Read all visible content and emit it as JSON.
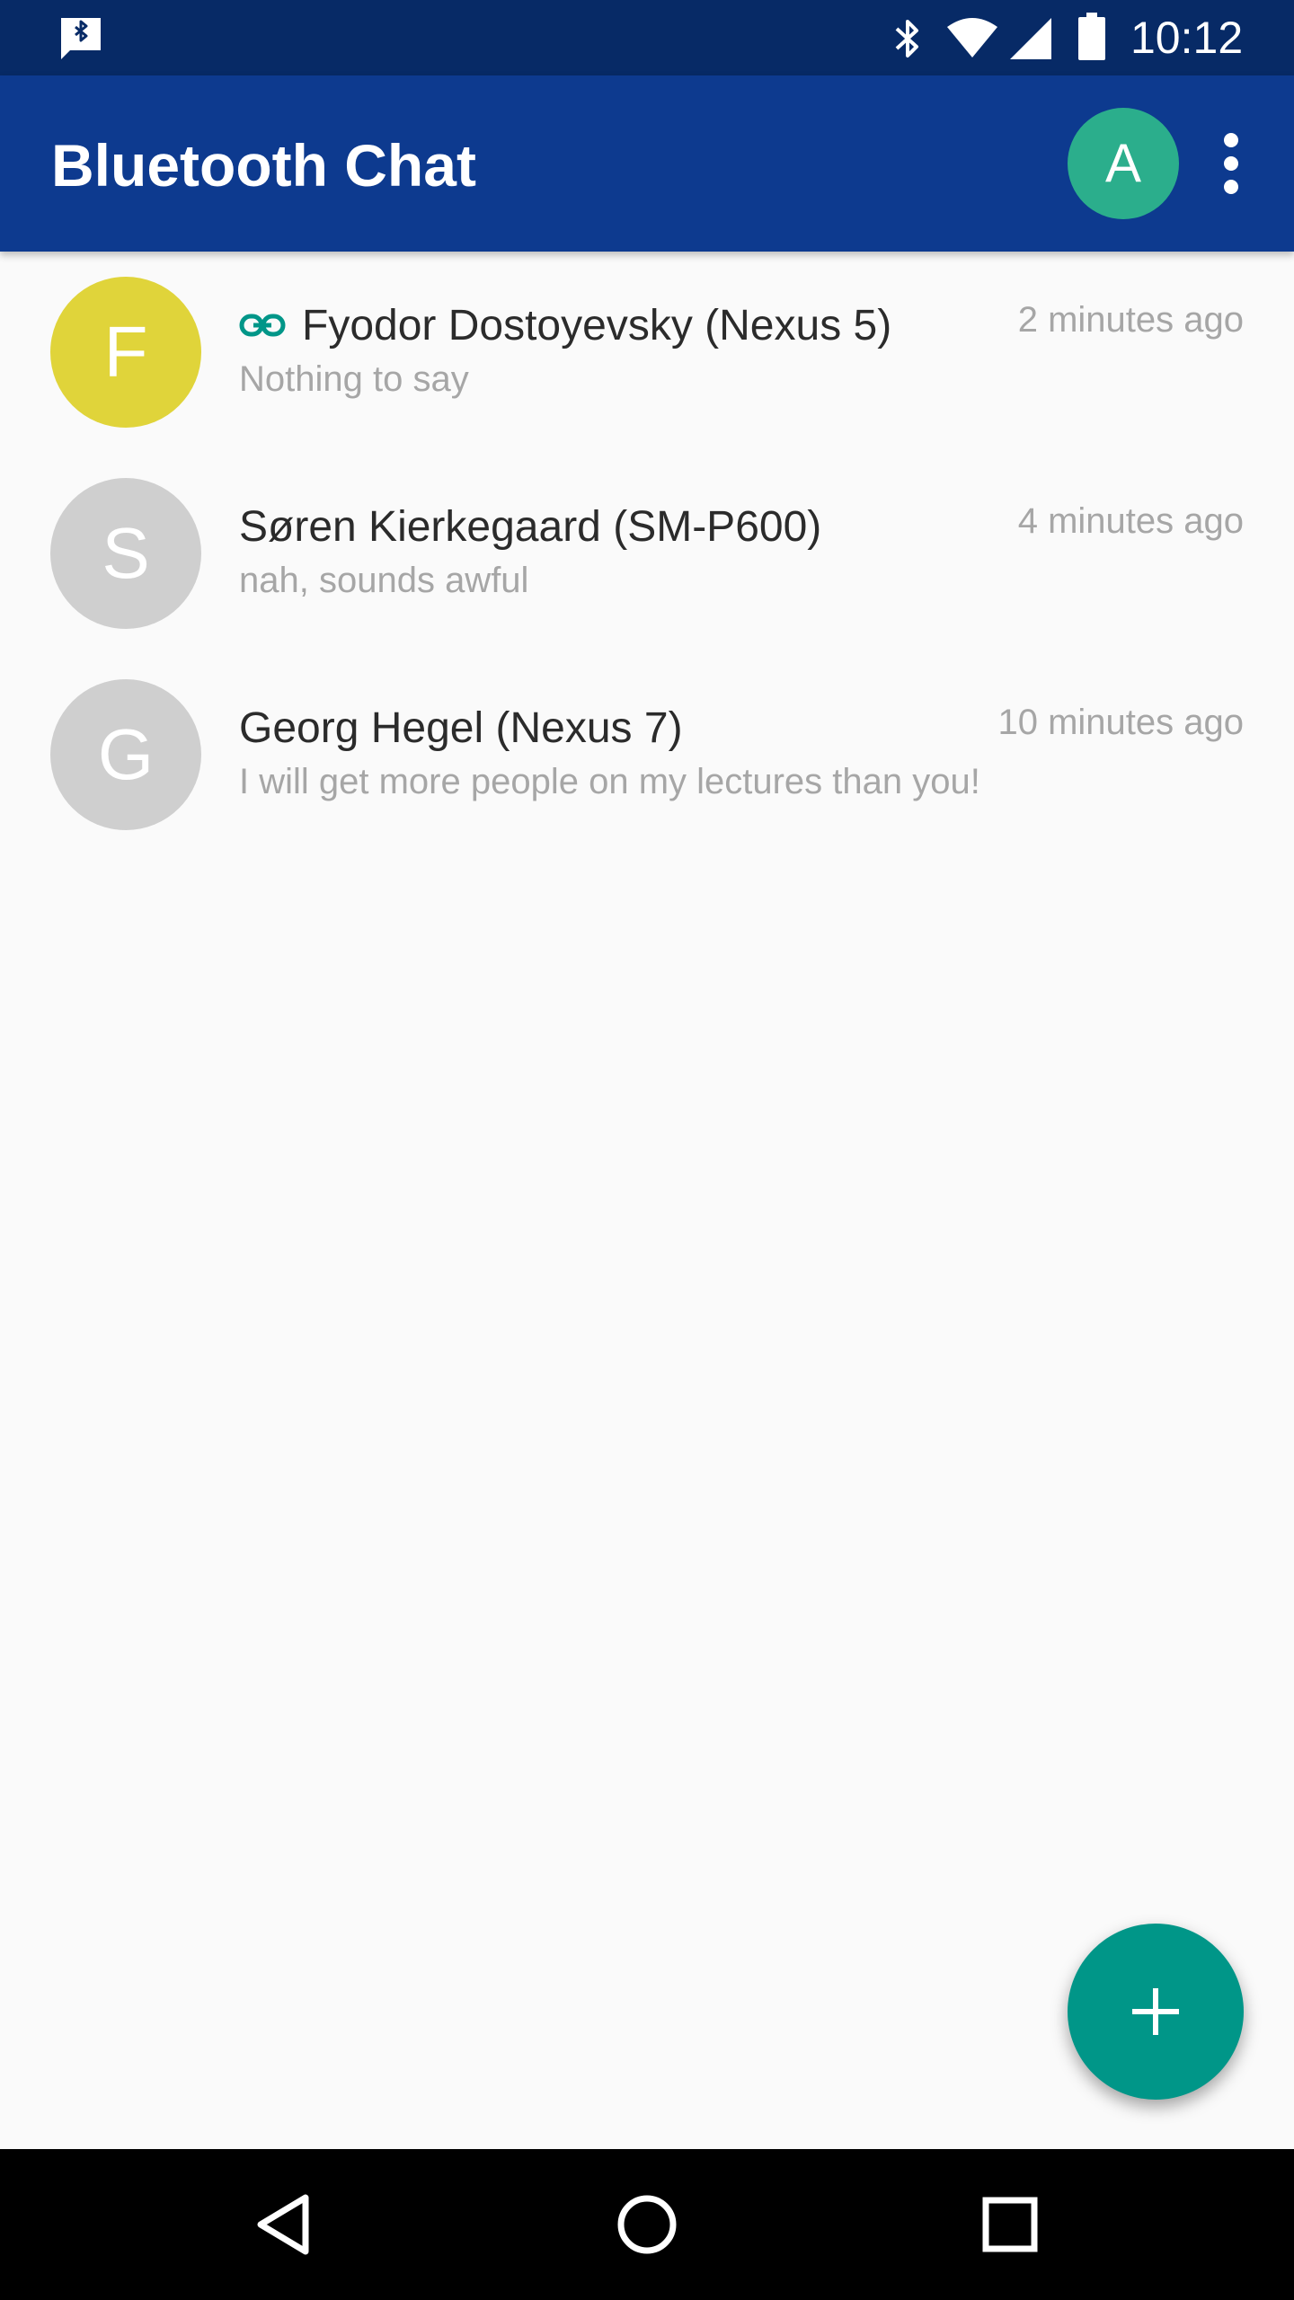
{
  "status_bar": {
    "time": "10:12",
    "icons": [
      "bluetooth-chat-notification-icon",
      "bluetooth-icon",
      "wifi-icon",
      "cell-signal-icon",
      "battery-icon"
    ]
  },
  "app_bar": {
    "title": "Bluetooth Chat",
    "account_initial": "A",
    "account_color": "#2bae8c",
    "background_color": "#0d3a8f"
  },
  "conversations": [
    {
      "initial": "F",
      "avatar_color": "#e0d43a",
      "name": "Fyodor Dostoyevsky (Nexus 5)",
      "connected": true,
      "time": "2 minutes ago",
      "preview": "Nothing to say"
    },
    {
      "initial": "S",
      "avatar_color": "#cfcfcf",
      "name": "Søren Kierkegaard (SM-P600)",
      "connected": false,
      "time": "4 minutes ago",
      "preview": "nah, sounds awful"
    },
    {
      "initial": "G",
      "avatar_color": "#cfcfcf",
      "name": "Georg Hegel (Nexus 7)",
      "connected": false,
      "time": "10 minutes ago",
      "preview": "I will get more people on my lectures than you!"
    }
  ],
  "fab": {
    "icon": "plus-icon",
    "color": "#009688"
  },
  "nav_bar": {
    "icons": [
      "back-icon",
      "home-icon",
      "recents-icon"
    ]
  }
}
